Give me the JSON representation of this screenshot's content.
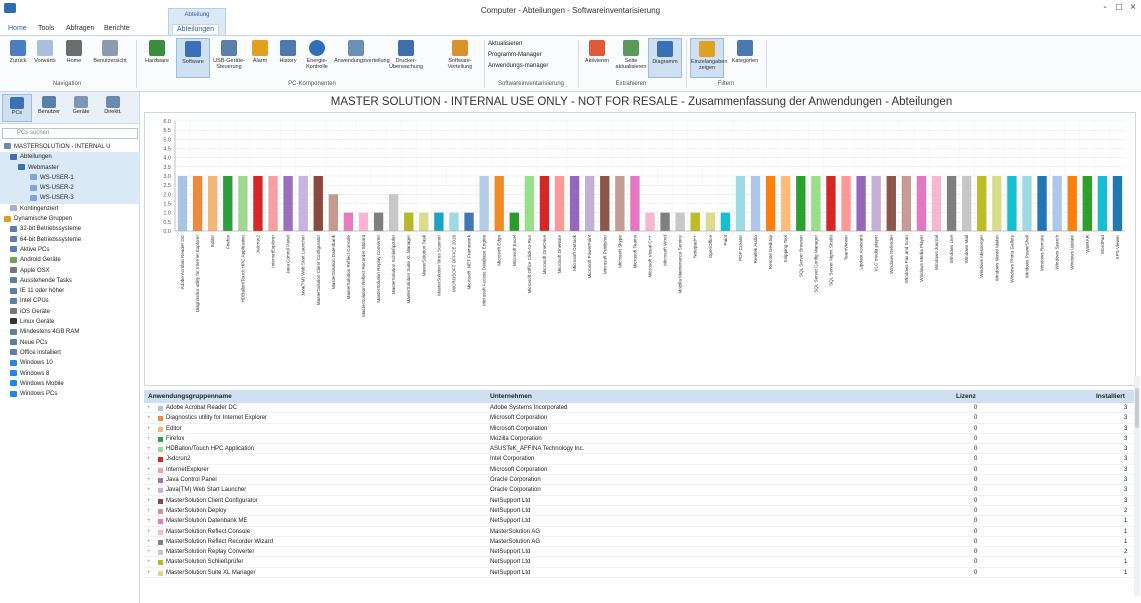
{
  "window": {
    "title": "Computer - Abteilungen - Softwareinventarisierung",
    "controls": [
      "-",
      "□",
      "×"
    ]
  },
  "context_tab_header": "Abteilung",
  "tabs": [
    "Home",
    "Tools",
    "Abfragen",
    "Berichte",
    "Abteilungen"
  ],
  "ribbon": {
    "groups": [
      {
        "label": "Navigation",
        "buttons": [
          "Zurück",
          "Vorwärts",
          "Home",
          "Benutzersicht"
        ]
      },
      {
        "label": "PC-Komponenten",
        "buttons": [
          "Hardware",
          "Software",
          "USB-Geräte-Steuerung",
          "Alarm",
          "History",
          "Energie-Kontrolle",
          "Anwendungsverteilung",
          "Drucker-Überwachung",
          "Software-Verteilung"
        ]
      },
      {
        "label": "Softwareinventarisierung",
        "buttons": [
          "Aktualisieren",
          "Programm-Manager",
          "Anwendungs-manager"
        ]
      },
      {
        "label": "Extrahieren",
        "buttons": [
          "Aktivieren",
          "Seite aktualisieren",
          "Diagramm"
        ]
      },
      {
        "label": "Filtern",
        "buttons": [
          "Einzelangaben zeigen",
          "Kategorien"
        ]
      }
    ]
  },
  "nav": {
    "buttons": [
      "PCs",
      "Benutzer",
      "Geräte",
      "Direktt."
    ],
    "search_placeholder": "PCs suchen",
    "tree": [
      "MASTERSOLUTION - INTERNAL U",
      "Abteilungen",
      "Webmaster",
      "WS-USER-1",
      "WS-USER-2",
      "WS-USER-3",
      "Kontingenziert",
      "Dynamische Gruppen",
      "32-bit Betriebssysteme",
      "64-bit Betriebssysteme",
      "Aktive PCs",
      "Android Geräte",
      "Apple OSX",
      "Ausstehende Tasks",
      "IE 11 oder höher",
      "Intel CPUs",
      "iOS Geräte",
      "Linux Geräte",
      "Mindestens 4GB RAM",
      "Neue PCs",
      "Office installiert",
      "Windows 10",
      "Windows 8",
      "Windows Mobile",
      "Windows PCs"
    ]
  },
  "chart_data": {
    "type": "bar",
    "title": "MASTER SOLUTION - INTERNAL USE ONLY - NOT FOR RESALE - Zusammenfassung der Anwendungen - Abteilungen",
    "ylim": [
      0,
      6
    ],
    "yticks": [
      "0.0",
      "0.5",
      "1.0",
      "1.5",
      "2.0",
      "2.5",
      "3.0",
      "3.5",
      "4.0",
      "4.5",
      "5.0",
      "5.5",
      "6.0"
    ],
    "categories": [
      "Adobe Acrobat Reader DC",
      "Diagnostics utility for Internet Explorer",
      "Editor",
      "Firefox",
      "HDBallon/Touch HPC Application",
      "Jsdcrun2",
      "InternetExplorer",
      "Java Control Panel",
      "Java(TM) Web Start Launcher",
      "MasterSolution Client Configurator",
      "MasterSolution Datenbank",
      "MasterSolution Reflect Console",
      "MasterSolution Reflect Recorder Wizard",
      "MasterSolution Replay Converter",
      "MasterSolution Schließprüfer",
      "MasterSolution Suite XL Manager",
      "MasterSolution Task",
      "MasterSolution Virus Scanner",
      "MICROSOFT OFFICE 2016",
      "Microsoft .NET Framework",
      "Microsoft Access Database Engine",
      "Microsoft Edge",
      "Microsoft Excel",
      "Microsoft Office Click-to-Run",
      "Microsoft OneDrive",
      "Microsoft OneNote",
      "Microsoft Outlook",
      "Microsoft PowerPoint",
      "Microsoft Publisher",
      "Microsoft Skype",
      "Microsoft Teams",
      "Microsoft Visual C++",
      "Microsoft Word",
      "Mozilla Maintenance Service",
      "Notepad++",
      "OpenOffice",
      "Paint",
      "PDF Creator",
      "Realtek Audio",
      "Remote Desktop",
      "Snipping Tool",
      "SQL Server Browser",
      "SQL Server Config Manager",
      "SQL Server Mgmt Studio",
      "TeamViewer",
      "Update Assistant",
      "VLC media player",
      "Windows Defender",
      "Windows Fax and Scan",
      "Windows Media Player",
      "Windows Journal",
      "Windows Live",
      "Windows Mail",
      "Windows Messenger",
      "Windows Movie Maker",
      "Windows Photo Gallery",
      "Windows PowerShell",
      "Windows Remote",
      "Windows Search",
      "Windows Update",
      "WinRAR",
      "WordPad",
      "XPS Viewer"
    ],
    "values": [
      3,
      3,
      3,
      3,
      3,
      3,
      3,
      3,
      3,
      3,
      2,
      1,
      1,
      1,
      2,
      1,
      1,
      1,
      1,
      1,
      3,
      3,
      1,
      3,
      3,
      3,
      3,
      3,
      3,
      3,
      3,
      1,
      1,
      1,
      1,
      1,
      1,
      3,
      3,
      3,
      3,
      3,
      3,
      3,
      3,
      3,
      3,
      3,
      3,
      3,
      3,
      3,
      3,
      3,
      3,
      3,
      3,
      3,
      3,
      3,
      3,
      3,
      3
    ],
    "colors": [
      "#a9c4e4",
      "#ef8a3c",
      "#f4b57a",
      "#2e9e3e",
      "#9fd88e",
      "#d62728",
      "#f5a0a0",
      "#9a6fc0",
      "#c9b3e0",
      "#8c4a3e",
      "#c49a90",
      "#e67ac3",
      "#f7b6d2",
      "#7f7f7f",
      "#c7c7c7",
      "#b8b82a",
      "#dbdb8d",
      "#1ca3c4",
      "#9edae5",
      "#3f78b5",
      "#b3cce8",
      "#f08a24",
      "#2a9a2a",
      "#98df8a",
      "#d62728",
      "#ff9896",
      "#9467bd",
      "#c5b0d5",
      "#8c564b",
      "#c49c94",
      "#e377c2",
      "#f7b6d2",
      "#7f7f7f",
      "#c7c7c7",
      "#bcbd22",
      "#dbdb8d",
      "#17becf",
      "#9edae5",
      "#aec7e8",
      "#ff7f0e",
      "#ffbb78",
      "#2ca02c",
      "#98df8a",
      "#d62728",
      "#ff9896",
      "#9467bd",
      "#c5b0d5",
      "#8c564b",
      "#c49c94",
      "#e377c2",
      "#f7b6d2",
      "#7f7f7f",
      "#c7c7c7",
      "#bcbd22",
      "#dbdb8d",
      "#17becf",
      "#9edae5",
      "#1f77b4",
      "#aec7e8",
      "#ff7f0e",
      "#2ca02c",
      "#17becf",
      "#1f77b4"
    ]
  },
  "grid": {
    "headers": [
      "Anwendungsgruppenname",
      "Unternehmen",
      "Lizenz",
      "Installiert"
    ],
    "rows": [
      {
        "name": "Adobe Acrobat Reader DC",
        "vendor": "Adobe Systems Incorporated",
        "lic": "0",
        "inst": "3",
        "color": "#a9c4e4"
      },
      {
        "name": "Diagnostics utility for Internet Explorer",
        "vendor": "Microsoft Corporation",
        "lic": "0",
        "inst": "3",
        "color": "#ef8a3c"
      },
      {
        "name": "Editor",
        "vendor": "Microsoft Corporation",
        "lic": "0",
        "inst": "3",
        "color": "#f4b57a"
      },
      {
        "name": "Firefox",
        "vendor": "Mozilla Corporation",
        "lic": "0",
        "inst": "3",
        "color": "#2e9e3e"
      },
      {
        "name": "HDBallon/Touch HPC Application",
        "vendor": "ASUSTeK_AFFINA Technology Inc.",
        "lic": "0",
        "inst": "3",
        "color": "#9fd88e"
      },
      {
        "name": "Jsdcrun2",
        "vendor": "Intel Corporation",
        "lic": "0",
        "inst": "3",
        "color": "#d62728"
      },
      {
        "name": "InternetExplorer",
        "vendor": "Microsoft Corporation",
        "lic": "0",
        "inst": "3",
        "color": "#f5a0a0"
      },
      {
        "name": "Java Control Panel",
        "vendor": "Oracle Corporation",
        "lic": "0",
        "inst": "3",
        "color": "#9a6fc0"
      },
      {
        "name": "Java(TM) Web Start Launcher",
        "vendor": "Oracle Corporation",
        "lic": "0",
        "inst": "3",
        "color": "#c9b3e0"
      },
      {
        "name": "MasterSolution Client Configurator",
        "vendor": "NetSupport Ltd",
        "lic": "0",
        "inst": "3",
        "color": "#8c4a3e"
      },
      {
        "name": "MasterSolution Deploy",
        "vendor": "NetSupport Ltd",
        "lic": "0",
        "inst": "2",
        "color": "#c49a90"
      },
      {
        "name": "MasterSolution Datenbank ME",
        "vendor": "NetSupport Ltd",
        "lic": "0",
        "inst": "1",
        "color": "#e67ac3"
      },
      {
        "name": "MasterSolution Reflect Console",
        "vendor": "MasterSolution AG",
        "lic": "0",
        "inst": "1",
        "color": "#f7b6d2"
      },
      {
        "name": "MasterSolution Reflect Recorder Wizard",
        "vendor": "MasterSolution AG",
        "lic": "0",
        "inst": "1",
        "color": "#7f7f7f"
      },
      {
        "name": "MasterSolution Replay Converter",
        "vendor": "NetSupport Ltd",
        "lic": "0",
        "inst": "2",
        "color": "#c7c7c7"
      },
      {
        "name": "MasterSolution Schließprüfer",
        "vendor": "NetSupport Ltd",
        "lic": "0",
        "inst": "1",
        "color": "#b8b82a"
      },
      {
        "name": "MasterSolution Suite XL Manager",
        "vendor": "NetSupport Ltd",
        "lic": "0",
        "inst": "1",
        "color": "#dbdb8d"
      }
    ]
  }
}
